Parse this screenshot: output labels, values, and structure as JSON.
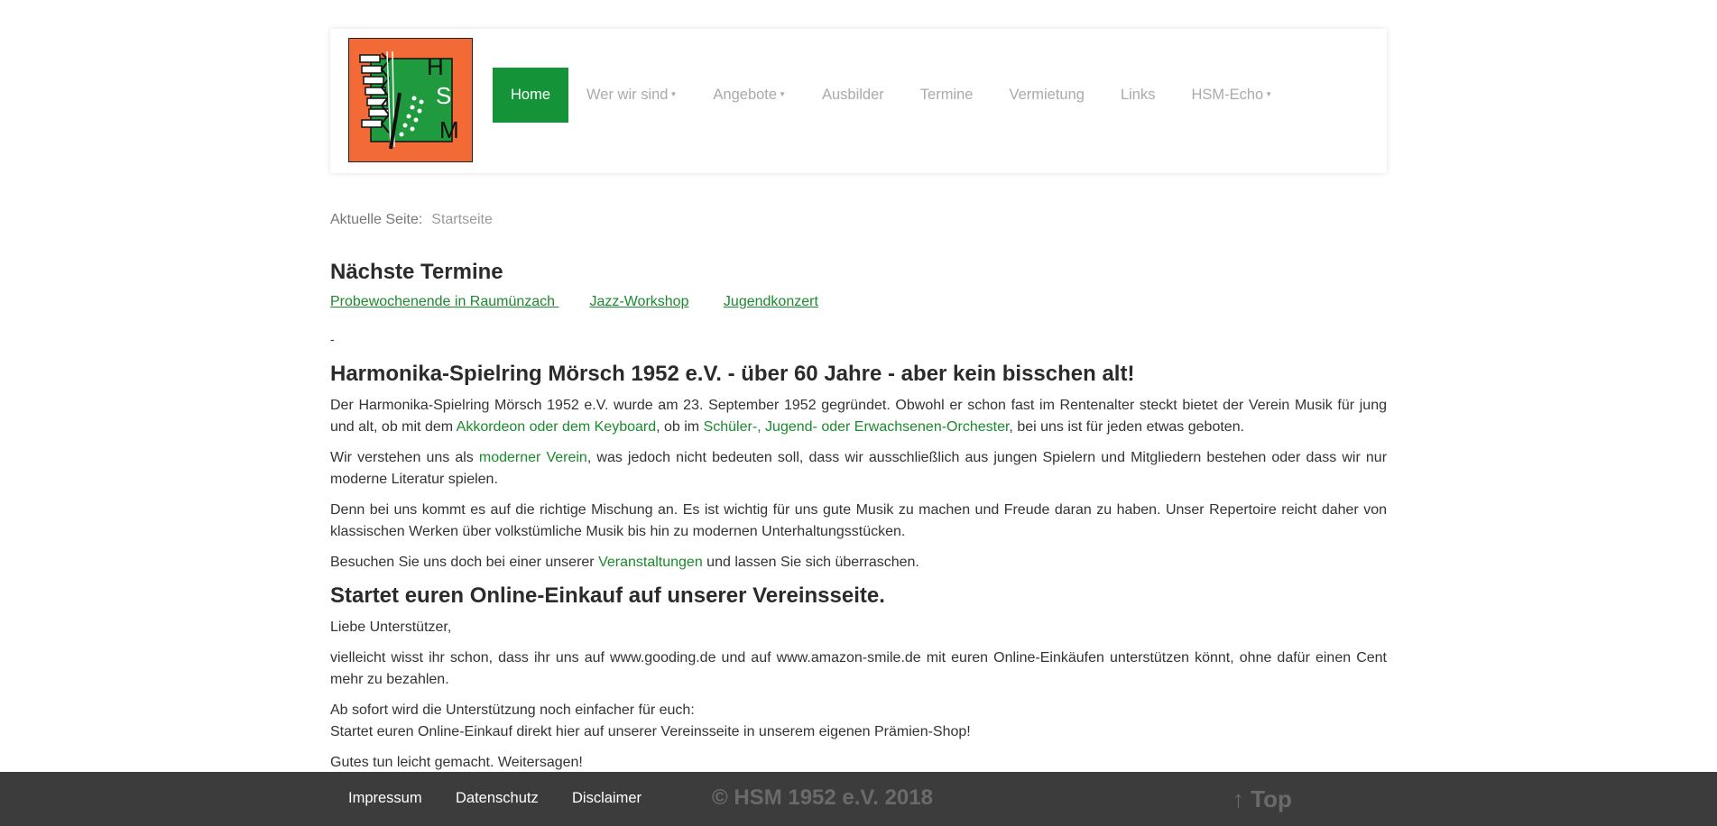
{
  "logo": {
    "letters": [
      "H",
      "S",
      "M"
    ]
  },
  "nav": {
    "items": [
      {
        "label": "Home",
        "active": true,
        "dropdown": false
      },
      {
        "label": "Wer wir sind",
        "active": false,
        "dropdown": true
      },
      {
        "label": "Angebote",
        "active": false,
        "dropdown": true
      },
      {
        "label": "Ausbilder",
        "active": false,
        "dropdown": false
      },
      {
        "label": "Termine",
        "active": false,
        "dropdown": false
      },
      {
        "label": "Vermietung",
        "active": false,
        "dropdown": false
      },
      {
        "label": "Links",
        "active": false,
        "dropdown": false
      },
      {
        "label": "HSM-Echo",
        "active": false,
        "dropdown": true
      }
    ]
  },
  "breadcrumb": {
    "label": "Aktuelle Seite:",
    "current": "Startseite"
  },
  "termine": {
    "title": "Nächste Termine",
    "links": [
      "Probewochenende in Raumünzach ",
      "Jazz-Workshop",
      "Jugendkonzert"
    ],
    "separator": "-"
  },
  "article": {
    "title": "Harmonika-Spielring Mörsch 1952 e.V. - über 60 Jahre - aber kein bisschen alt!",
    "p1_a": "Der Harmonika-Spielring Mörsch 1952 e.V. wurde am 23. September 1952 gegründet. Obwohl er schon fast im Rentenalter steckt bietet der Verein Musik für jung und alt, ob mit dem ",
    "p1_link1": "Akkordeon oder dem Keyboard",
    "p1_b": ", ob im ",
    "p1_link2": "Schüler-, Jugend- oder Erwachsenen-Orchester",
    "p1_c": ", bei uns ist für jeden etwas geboten.",
    "p2_a": "Wir verstehen uns als ",
    "p2_link": "moderner Verein",
    "p2_b": ", was jedoch nicht bedeuten soll, dass wir ausschließlich aus jungen Spielern und Mitgliedern bestehen oder dass wir nur moderne Literatur spielen.",
    "p3": "Denn bei uns kommt es auf die richtige Mischung an. Es ist wichtig für uns gute Musik zu machen und Freude daran zu haben. Unser Repertoire reicht daher von klassischen Werken über volkstümliche Musik bis hin zu modernen Unterhaltungsstücken.",
    "p4_a": "Besuchen Sie uns doch bei einer unserer ",
    "p4_link": "Veranstaltungen",
    "p4_b": " und lassen Sie sich überraschen."
  },
  "shop": {
    "title": "Startet euren Online-Einkauf auf unserer Vereinsseite.",
    "greeting": "Liebe Unterstützer,",
    "p1": "vielleicht wisst ihr schon, dass ihr uns auf www.gooding.de und auf www.amazon-smile.de mit euren Online-Einkäufen unterstützen könnt, ohne dafür einen Cent mehr zu bezahlen.",
    "p2_line1": "Ab sofort wird die Unterstützung noch einfacher für euch:",
    "p2_line2": "Startet euren Online-Einkauf direkt hier auf unserer Vereinsseite in unserem eigenen Prämien-Shop!",
    "p3": "Gutes tun leicht gemacht. Weitersagen!"
  },
  "footer": {
    "impressum": "Impressum",
    "datenschutz": "Datenschutz",
    "disclaimer": "Disclaimer",
    "copyright": "© HSM 1952 e.V. 2018",
    "top": "↑ Top"
  },
  "colors": {
    "accent": "#149339",
    "link": "#1a8a2c",
    "logo_orange": "#f26a36",
    "logo_green": "#1f9a3e",
    "footer_bg": "#3c3c3c"
  }
}
